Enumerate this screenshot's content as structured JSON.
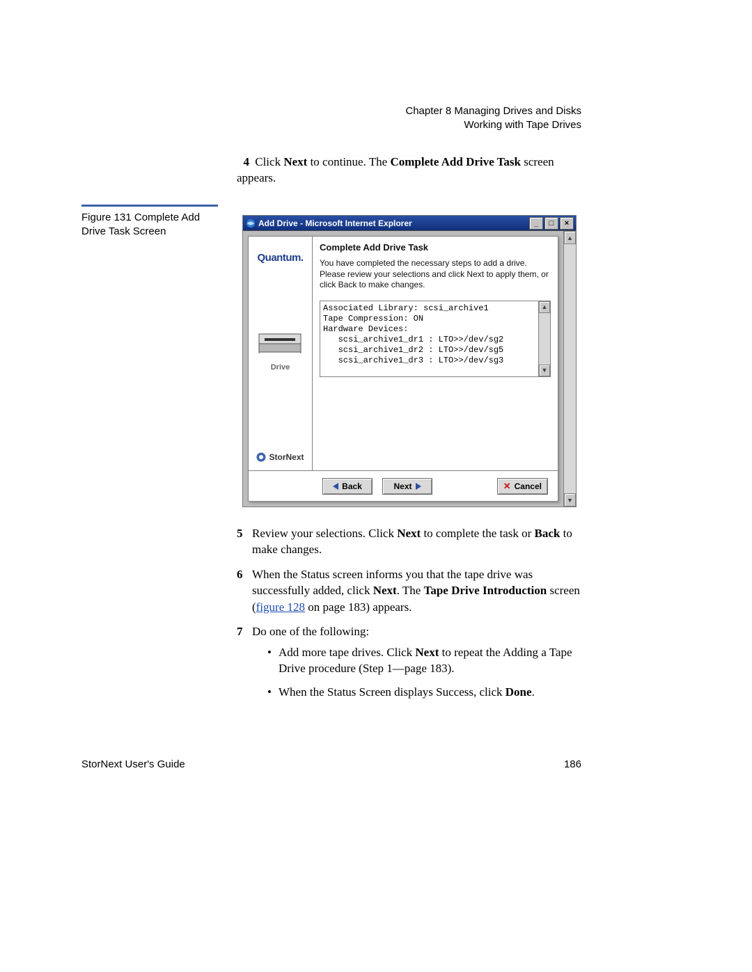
{
  "header": {
    "chapter": "Chapter 8  Managing Drives and Disks",
    "section": "Working with Tape Drives"
  },
  "step4": {
    "num": "4",
    "pre": "Click ",
    "next": "Next",
    "mid": " to continue. The ",
    "complete": "Complete Add Drive Task",
    "post": " screen appears."
  },
  "figure_caption": "Figure 131  Complete Add Drive Task Screen",
  "screenshot": {
    "title": "Add Drive - Microsoft Internet Explorer",
    "sidebar": {
      "logo": "Quantum.",
      "drive_label": "Drive",
      "stornext": "StorNext"
    },
    "main": {
      "title": "Complete Add Drive Task",
      "text": "You have completed the necessary steps to add a drive. Please review your selections and click Next to apply them, or click Back to make changes.",
      "review": "Associated Library: scsi_archive1\nTape Compression: ON\nHardware Devices:\n   scsi_archive1_dr1 : LTO>>/dev/sg2\n   scsi_archive1_dr2 : LTO>>/dev/sg5\n   scsi_archive1_dr3 : LTO>>/dev/sg3"
    },
    "buttons": {
      "back": "Back",
      "next": "Next",
      "cancel": "Cancel"
    },
    "window_controls": {
      "minimize": "_",
      "maximize": "□",
      "close": "×"
    }
  },
  "step5": {
    "num": "5",
    "t1": "Review your selections. Click ",
    "b1": "Next",
    "t2": " to complete the task or ",
    "b2": "Back",
    "t3": " to make changes."
  },
  "step6": {
    "num": "6",
    "t1": "When the Status screen informs you that the tape drive was successfully added, click ",
    "b1": "Next",
    "t2": ". The ",
    "b2": "Tape Drive Introduction",
    "t3": " screen (",
    "link": "figure 128",
    "t4": " on page 183) appears."
  },
  "step7": {
    "num": "7",
    "t1": "Do one of the following:",
    "bullet1_a": "Add more tape drives. Click ",
    "bullet1_b": "Next",
    "bullet1_c": " to repeat the Adding a Tape Drive procedure (Step 1—page 183).",
    "bullet2_a": "When the Status Screen displays Success, click ",
    "bullet2_b": "Done",
    "bullet2_c": "."
  },
  "footer": {
    "left": "StorNext User's Guide",
    "right": "186"
  }
}
